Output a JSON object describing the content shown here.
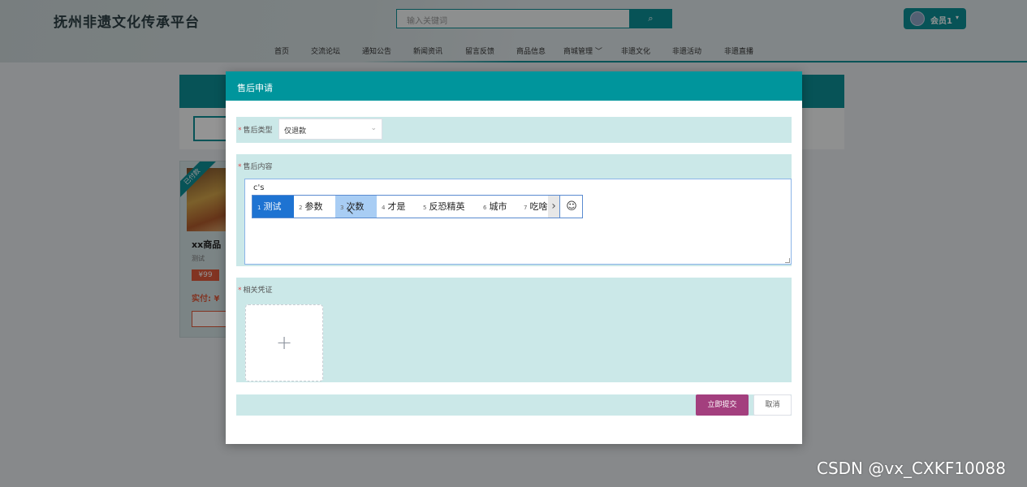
{
  "header": {
    "site_title": "抚州非遗文化传承平台",
    "search_placeholder": "输入关键词",
    "search_icon": "search-icon",
    "member_label": "会员1",
    "member_caret": "▾"
  },
  "nav": {
    "items": [
      {
        "label": "首页"
      },
      {
        "label": "交流论坛"
      },
      {
        "label": "通知公告"
      },
      {
        "label": "新闻资讯"
      },
      {
        "label": "留言反馈"
      },
      {
        "label": "商品信息"
      },
      {
        "label": "商城管理 ﹀"
      },
      {
        "label": "非遗文化"
      },
      {
        "label": "非遗活动"
      },
      {
        "label": "非遗直播"
      }
    ]
  },
  "background_card": {
    "ribbon": "已付款",
    "name": "xx商品",
    "subtitle": "测试",
    "price": "¥99",
    "paid": "实付: ¥"
  },
  "modal": {
    "title": "售后申请",
    "type_label": "售后类型",
    "type_value": "仅退款",
    "content_label": "售后内容",
    "content_typed": "c's",
    "proof_label": "相关凭证",
    "upload_plus": "+",
    "submit_label": "立即提交",
    "cancel_label": "取消",
    "required_mark": "*"
  },
  "ime": {
    "candidates": [
      {
        "num": "1",
        "text": "测试"
      },
      {
        "num": "2",
        "text": "参数"
      },
      {
        "num": "3",
        "text": "次数"
      },
      {
        "num": "4",
        "text": "才是"
      },
      {
        "num": "5",
        "text": "反恐精英"
      },
      {
        "num": "6",
        "text": "城市"
      },
      {
        "num": "7",
        "text": "吃啥"
      }
    ],
    "next_arrow": "›",
    "emoji": "☺"
  },
  "watermark": "CSDN @vx_CXKF10088",
  "colors": {
    "accent": "#0d8f97",
    "modal_header": "#00959c",
    "form_row": "#cbe8e8",
    "submit": "#a33f7e",
    "ime_selected": "#1e73d2"
  }
}
